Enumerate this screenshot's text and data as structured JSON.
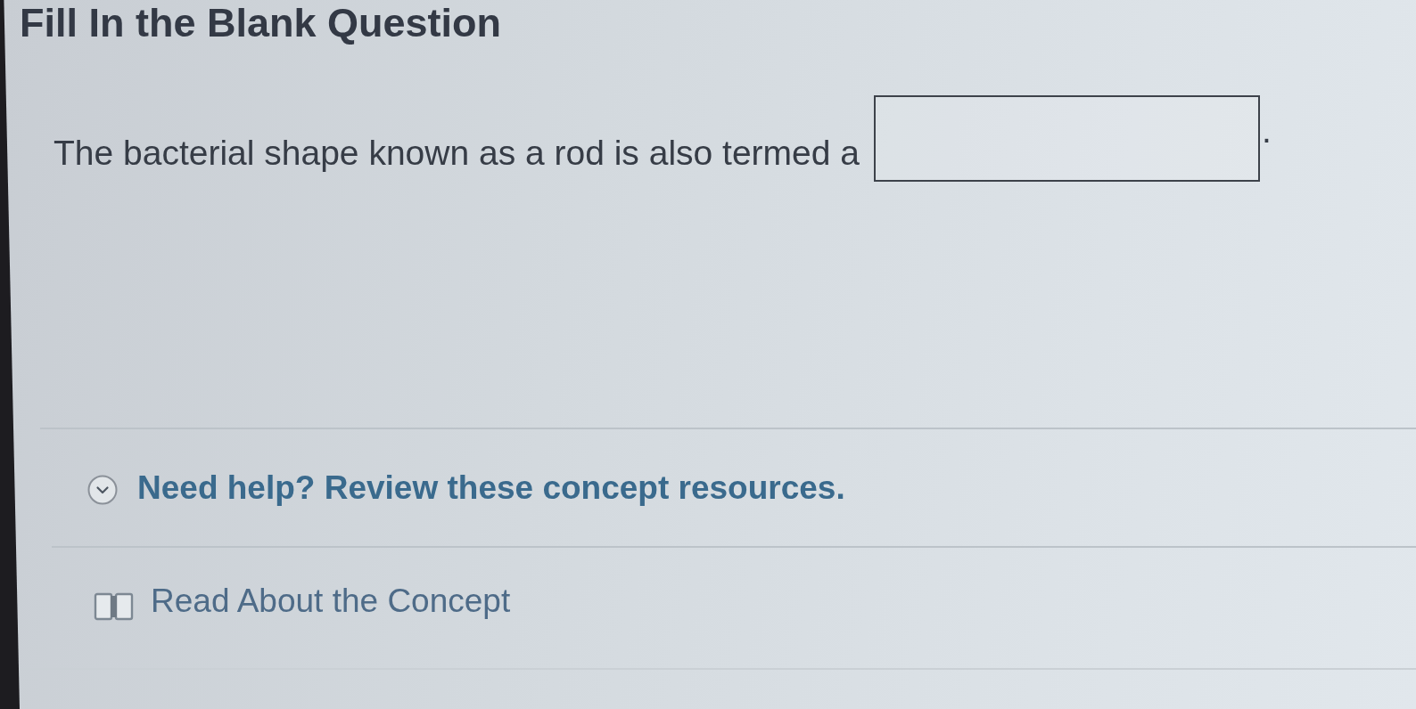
{
  "title": "Fill In the Blank Question",
  "question": {
    "parts": [
      {
        "kind": "text",
        "text": "The bacterial shape known as a rod is also termed a"
      },
      {
        "kind": "blank"
      },
      {
        "kind": "text",
        "text": "."
      }
    ]
  },
  "help": {
    "label": "Need help? Review these concept resources.",
    "expanded": true,
    "resources": [
      {
        "kind": "reading",
        "label": "Read About the Concept"
      }
    ]
  }
}
